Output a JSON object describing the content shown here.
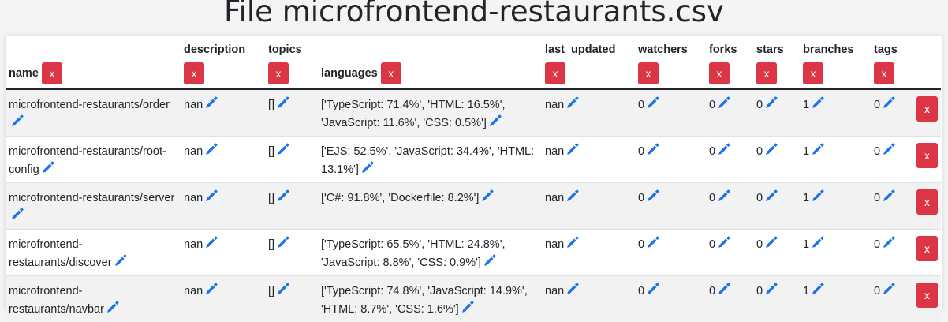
{
  "page_title": "File microfrontend-restaurants.csv",
  "delete_label": "x",
  "pencil_color": "#1a73e8",
  "danger_color": "#dc3545",
  "columns": [
    {
      "key": "name",
      "label": "name"
    },
    {
      "key": "description",
      "label": "description"
    },
    {
      "key": "topics",
      "label": "topics"
    },
    {
      "key": "languages",
      "label": "languages"
    },
    {
      "key": "last_updated",
      "label": "last_updated"
    },
    {
      "key": "watchers",
      "label": "watchers"
    },
    {
      "key": "forks",
      "label": "forks"
    },
    {
      "key": "stars",
      "label": "stars"
    },
    {
      "key": "branches",
      "label": "branches"
    },
    {
      "key": "tags",
      "label": "tags"
    }
  ],
  "rows": [
    {
      "name": "microfrontend-restaurants/order",
      "description": "nan",
      "topics": "[]",
      "languages": "['TypeScript: 71.4%', 'HTML: 16.5%', 'JavaScript: 11.6%', 'CSS: 0.5%']",
      "last_updated": "nan",
      "watchers": "0",
      "forks": "0",
      "stars": "0",
      "branches": "1",
      "tags": "0"
    },
    {
      "name": "microfrontend-restaurants/root-config",
      "description": "nan",
      "topics": "[]",
      "languages": "['EJS: 52.5%', 'JavaScript: 34.4%', 'HTML: 13.1%']",
      "last_updated": "nan",
      "watchers": "0",
      "forks": "0",
      "stars": "0",
      "branches": "1",
      "tags": "0"
    },
    {
      "name": "microfrontend-restaurants/server",
      "description": "nan",
      "topics": "[]",
      "languages": "['C#: 91.8%', 'Dockerfile: 8.2%']",
      "last_updated": "nan",
      "watchers": "0",
      "forks": "0",
      "stars": "0",
      "branches": "1",
      "tags": "0"
    },
    {
      "name": "microfrontend-restaurants/discover",
      "description": "nan",
      "topics": "[]",
      "languages": "['TypeScript: 65.5%', 'HTML: 24.8%', 'JavaScript: 8.8%', 'CSS: 0.9%']",
      "last_updated": "nan",
      "watchers": "0",
      "forks": "0",
      "stars": "0",
      "branches": "1",
      "tags": "0"
    },
    {
      "name": "microfrontend-restaurants/navbar",
      "description": "nan",
      "topics": "[]",
      "languages": "['TypeScript: 74.8%', 'JavaScript: 14.9%', 'HTML: 8.7%', 'CSS: 1.6%']",
      "last_updated": "nan",
      "watchers": "0",
      "forks": "0",
      "stars": "0",
      "branches": "1",
      "tags": "0"
    }
  ]
}
